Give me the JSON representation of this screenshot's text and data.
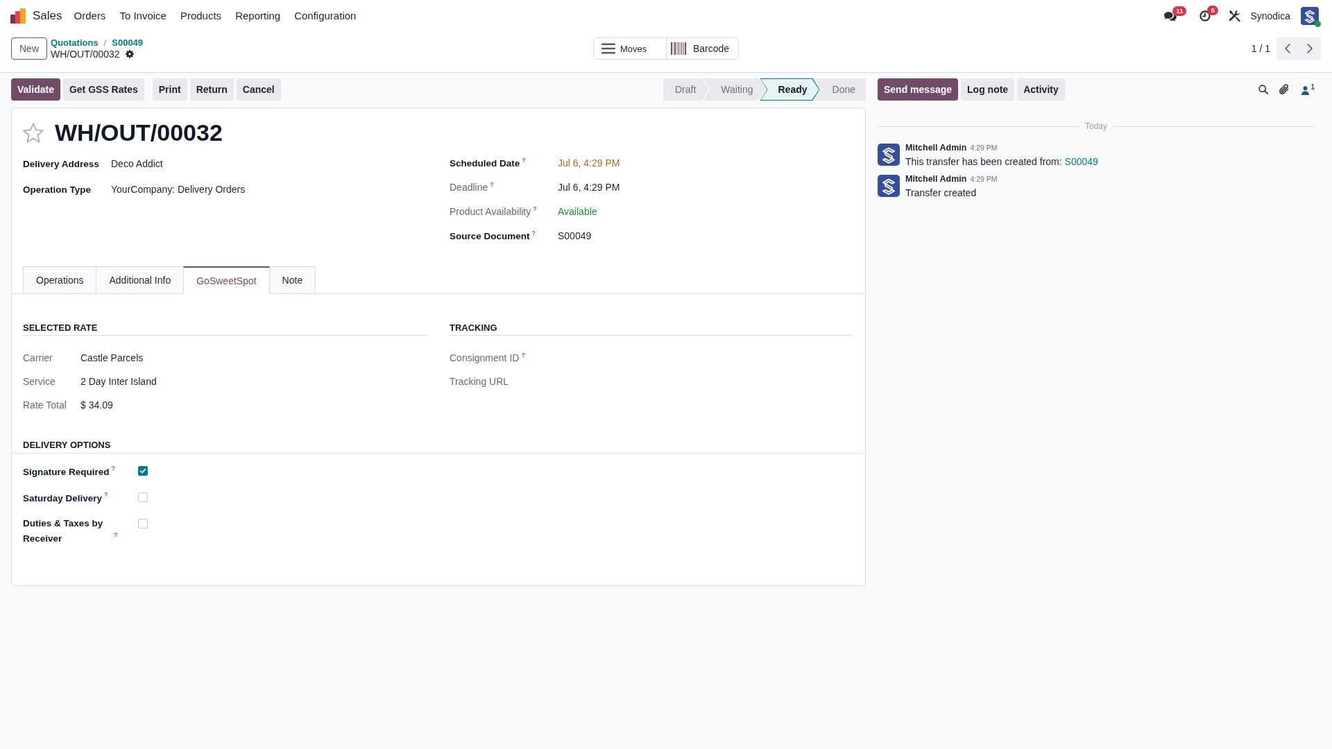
{
  "navbar": {
    "app_name": "Sales",
    "menu": [
      "Orders",
      "To Invoice",
      "Products",
      "Reporting",
      "Configuration"
    ],
    "messages_badge": "11",
    "activities_badge": "5",
    "company": "Synodica",
    "user_online": true
  },
  "control_panel": {
    "new_button": "New",
    "breadcrumbs": [
      "Quotations",
      "S00049"
    ],
    "breadcrumb_separator": "/",
    "record_name": "WH/OUT/00032",
    "smart_buttons": [
      {
        "label": "Moves",
        "kind": "list"
      },
      {
        "label": "Barcode",
        "kind": "barcode"
      }
    ],
    "pager": "1 / 1"
  },
  "actions": {
    "button_groups": [
      [
        {
          "label": "Validate",
          "kind": "primary"
        },
        {
          "label": "Get GSS Rates",
          "kind": "secondary"
        }
      ],
      [
        {
          "label": "Print",
          "kind": "secondary"
        },
        {
          "label": "Return",
          "kind": "secondary"
        },
        {
          "label": "Cancel",
          "kind": "secondary"
        }
      ]
    ],
    "status": [
      {
        "label": "Draft",
        "selected": false
      },
      {
        "label": "Waiting",
        "selected": false
      },
      {
        "label": "Ready",
        "selected": true
      },
      {
        "label": "Done",
        "selected": false
      }
    ]
  },
  "form": {
    "favorite": false,
    "title": "WH/OUT/00032",
    "left_fields": [
      {
        "label": "Delivery Address",
        "readonly": false,
        "value": "Deco Addict"
      },
      {
        "label": "Operation Type",
        "readonly": false,
        "value": "YourCompany: Delivery Orders"
      }
    ],
    "right_fields": [
      {
        "label": "Scheduled Date",
        "help": "?",
        "readonly": false,
        "value": "Jul 6, 4:29 PM",
        "color": "#a96d1e"
      },
      {
        "label": "Deadline",
        "help": "?",
        "readonly": true,
        "value": "Jul 6, 4:29 PM"
      },
      {
        "label": "Product Availability",
        "help": "?",
        "readonly": true,
        "value": "Available",
        "color": "#1d8f3a"
      },
      {
        "label": "Source Document",
        "help": "?",
        "readonly": false,
        "value": "S00049"
      }
    ],
    "tabs": [
      {
        "label": "Operations",
        "selected": false
      },
      {
        "label": "Additional Info",
        "selected": false
      },
      {
        "label": "GoSweetSpot",
        "selected": true
      },
      {
        "label": "Note",
        "selected": false
      }
    ],
    "selected_rate": {
      "title": "SELECTED RATE",
      "fields": [
        {
          "label": "Carrier",
          "readonly": true,
          "value": "Castle Parcels"
        },
        {
          "label": "Service",
          "readonly": true,
          "value": "2 Day Inter Island"
        },
        {
          "label": "Rate Total",
          "readonly": true,
          "value": "$ 34.09"
        }
      ]
    },
    "tracking": {
      "title": "TRACKING",
      "fields": [
        {
          "label": "Consignment ID",
          "help": "?",
          "readonly": true
        },
        {
          "label": "Tracking URL",
          "readonly": true
        }
      ]
    },
    "delivery_options": {
      "title": "DELIVERY OPTIONS",
      "options": [
        {
          "label": "Signature Required",
          "help": "?",
          "checked": true
        },
        {
          "label": "Saturday Delivery",
          "help": "?",
          "checked": false
        },
        {
          "label": "Duties & Taxes by Receiver",
          "help": "?",
          "checked": false
        }
      ]
    }
  },
  "chatter": {
    "buttons": [
      {
        "label": "Send message",
        "kind": "primary"
      },
      {
        "label": "Log note",
        "kind": "secondary"
      },
      {
        "label": "Activity",
        "kind": "secondary"
      }
    ],
    "followers_count": "1",
    "date_separator": "Today",
    "messages": [
      {
        "author": "Mitchell Admin",
        "time": "4:29 PM",
        "body": "This transfer has been created from:",
        "link": "S00049"
      },
      {
        "author": "Mitchell Admin",
        "time": "4:29 PM",
        "body": "Transfer created"
      }
    ]
  }
}
